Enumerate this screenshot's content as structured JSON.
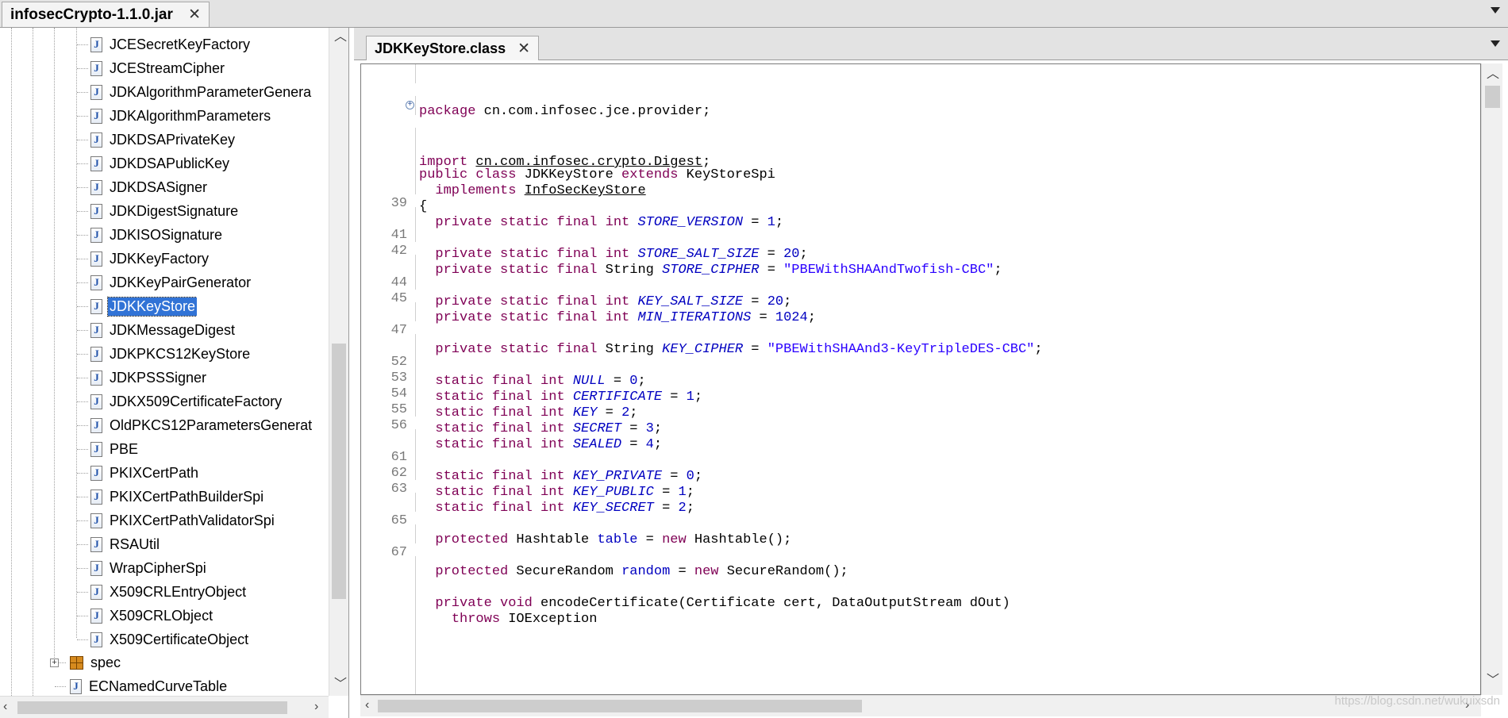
{
  "top_tab": {
    "label": "infosecCrypto-1.1.0.jar"
  },
  "editor_tab": {
    "label": "JDKKeyStore.class"
  },
  "tree": {
    "classes": [
      "JCESecretKeyFactory",
      "JCEStreamCipher",
      "JDKAlgorithmParameterGenera",
      "JDKAlgorithmParameters",
      "JDKDSAPrivateKey",
      "JDKDSAPublicKey",
      "JDKDSASigner",
      "JDKDigestSignature",
      "JDKISOSignature",
      "JDKKeyFactory",
      "JDKKeyPairGenerator",
      "JDKKeyStore",
      "JDKMessageDigest",
      "JDKPKCS12KeyStore",
      "JDKPSSSigner",
      "JDKX509CertificateFactory",
      "OldPKCS12ParametersGenerat",
      "PBE",
      "PKIXCertPath",
      "PKIXCertPathBuilderSpi",
      "PKIXCertPathValidatorSpi",
      "RSAUtil",
      "WrapCipherSpi",
      "X509CRLEntryObject",
      "X509CRLObject",
      "X509CertificateObject"
    ],
    "selected": "JDKKeyStore",
    "package_node": "spec",
    "after_package": "ECNamedCurveTable"
  },
  "code": {
    "package_line": [
      "package",
      " cn.com.infosec.jce.provider;"
    ],
    "import_kw": "import",
    "import_target": "cn.com.infosec.crypto.Digest",
    "semicolon": ";",
    "class_decl": [
      "public class",
      " JDKKeyStore ",
      "extends",
      " KeyStoreSpi"
    ],
    "implements_kw": "implements",
    "implements_target": "InfoSecKeyStore",
    "open_brace": "{",
    "line_numbers": [
      "39",
      "41",
      "42",
      "44",
      "45",
      "47",
      "52",
      "53",
      "54",
      "55",
      "56",
      "61",
      "62",
      "63",
      "65",
      "67"
    ],
    "psf_int": "private static final int",
    "psf_string_kw": "private static final",
    "string_type": "String",
    "sf_int": "static final int",
    "assign": " = ",
    "fields": {
      "store_version": [
        "STORE_VERSION",
        "1"
      ],
      "store_salt_size": [
        "STORE_SALT_SIZE",
        "20"
      ],
      "store_cipher": [
        "STORE_CIPHER",
        "\"PBEWithSHAAndTwofish-CBC\""
      ],
      "key_salt_size": [
        "KEY_SALT_SIZE",
        "20"
      ],
      "min_iterations": [
        "MIN_ITERATIONS",
        "1024"
      ],
      "key_cipher": [
        "KEY_CIPHER",
        "\"PBEWithSHAAnd3-KeyTripleDES-CBC\""
      ],
      "null": [
        "NULL",
        "0"
      ],
      "certificate": [
        "CERTIFICATE",
        "1"
      ],
      "key": [
        "KEY",
        "2"
      ],
      "secret": [
        "SECRET",
        "3"
      ],
      "sealed": [
        "SEALED",
        "4"
      ],
      "key_private": [
        "KEY_PRIVATE",
        "0"
      ],
      "key_public": [
        "KEY_PUBLIC",
        "1"
      ],
      "key_secret": [
        "KEY_SECRET",
        "2"
      ]
    },
    "protected_kw": "protected",
    "new_kw": "new",
    "hashtable_line": [
      " Hashtable ",
      "table",
      "Hashtable();"
    ],
    "securerandom_line": [
      " SecureRandom ",
      "random",
      "SecureRandom();"
    ],
    "method_kw": "private void",
    "method_rest": " encodeCertificate(Certificate cert, DataOutputStream dOut)",
    "throws_kw": "throws",
    "throws_rest": " IOException"
  },
  "watermark": "https://blog.csdn.net/wukuixsdn"
}
